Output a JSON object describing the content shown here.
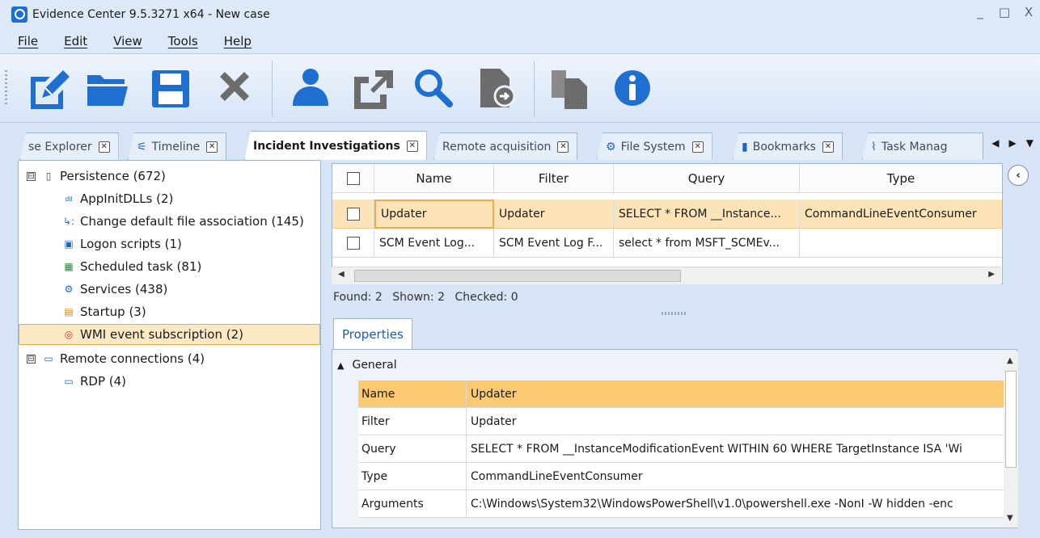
{
  "window": {
    "title": "Evidence Center 9.5.3271 x64 - New case",
    "controls": [
      "_",
      "□",
      "X"
    ]
  },
  "menu": [
    "File",
    "Edit",
    "View",
    "Tools",
    "Help"
  ],
  "toolbar": {
    "buttons": [
      "edit-icon",
      "open-folder-icon",
      "save-icon",
      "delete-icon",
      "user-icon",
      "export-icon",
      "search-icon",
      "import-icon",
      "copy-icon",
      "info-icon"
    ],
    "colors": {
      "accent": "#1e6fcf",
      "grey": "#6c6c6c"
    }
  },
  "tabs": [
    {
      "label": "se Explorer",
      "icon": ""
    },
    {
      "label": "Timeline",
      "icon": "timeline-icon"
    },
    {
      "label": "Incident Investigations",
      "icon": "",
      "active": true
    },
    {
      "label": "Remote acquisition",
      "icon": ""
    },
    {
      "label": "File System",
      "icon": "disk-icon"
    },
    {
      "label": "Bookmarks",
      "icon": "bookmark-icon"
    },
    {
      "label": "Task Manag",
      "icon": "pulse-icon"
    }
  ],
  "tree": [
    {
      "label": "Persistence (672)",
      "level": 0,
      "expander": "⊟",
      "icon": "▯"
    },
    {
      "label": "AppInitDLLs (2)",
      "level": 1,
      "icon": "dll"
    },
    {
      "label": "Change default file association (145)",
      "level": 1,
      "icon": "↳:"
    },
    {
      "label": "Logon scripts (1)",
      "level": 1,
      "icon": "▣"
    },
    {
      "label": "Scheduled task (81)",
      "level": 1,
      "icon": "▦"
    },
    {
      "label": "Services (438)",
      "level": 1,
      "icon": "⚙"
    },
    {
      "label": "Startup (3)",
      "level": 1,
      "icon": "▤"
    },
    {
      "label": "WMI event subscription (2)",
      "level": 1,
      "icon": "◎",
      "selected": true
    },
    {
      "label": "Remote connections (4)",
      "level": 0,
      "expander": "⊟",
      "icon": "▭"
    },
    {
      "label": "RDP (4)",
      "level": 1,
      "icon": "▭"
    }
  ],
  "grid": {
    "columns": [
      "Name",
      "Filter",
      "Query",
      "Type"
    ],
    "rows": [
      {
        "name": "Updater",
        "filter": "Updater",
        "query": "SELECT * FROM __Instance...",
        "type": "CommandLineEventConsumer",
        "selected": true
      },
      {
        "name": "SCM Event Log...",
        "filter": "SCM Event Log F...",
        "query": "select * from MSFT_SCMEv...",
        "type": ""
      }
    ]
  },
  "status": {
    "found": "Found: 2",
    "shown": "Shown: 2",
    "checked": "Checked: 0"
  },
  "properties": {
    "tab": "Properties",
    "group": "General",
    "rows": [
      {
        "key": "Name",
        "value": "Updater",
        "selected": true
      },
      {
        "key": "Filter",
        "value": "Updater"
      },
      {
        "key": "Query",
        "value": "SELECT * FROM __InstanceModificationEvent WITHIN 60 WHERE TargetInstance ISA 'Wi"
      },
      {
        "key": "Type",
        "value": "CommandLineEventConsumer"
      },
      {
        "key": "Arguments",
        "value": "C:\\Windows\\System32\\WindowsPowerShell\\v1.0\\powershell.exe -NonI -W hidden -enc"
      }
    ]
  }
}
